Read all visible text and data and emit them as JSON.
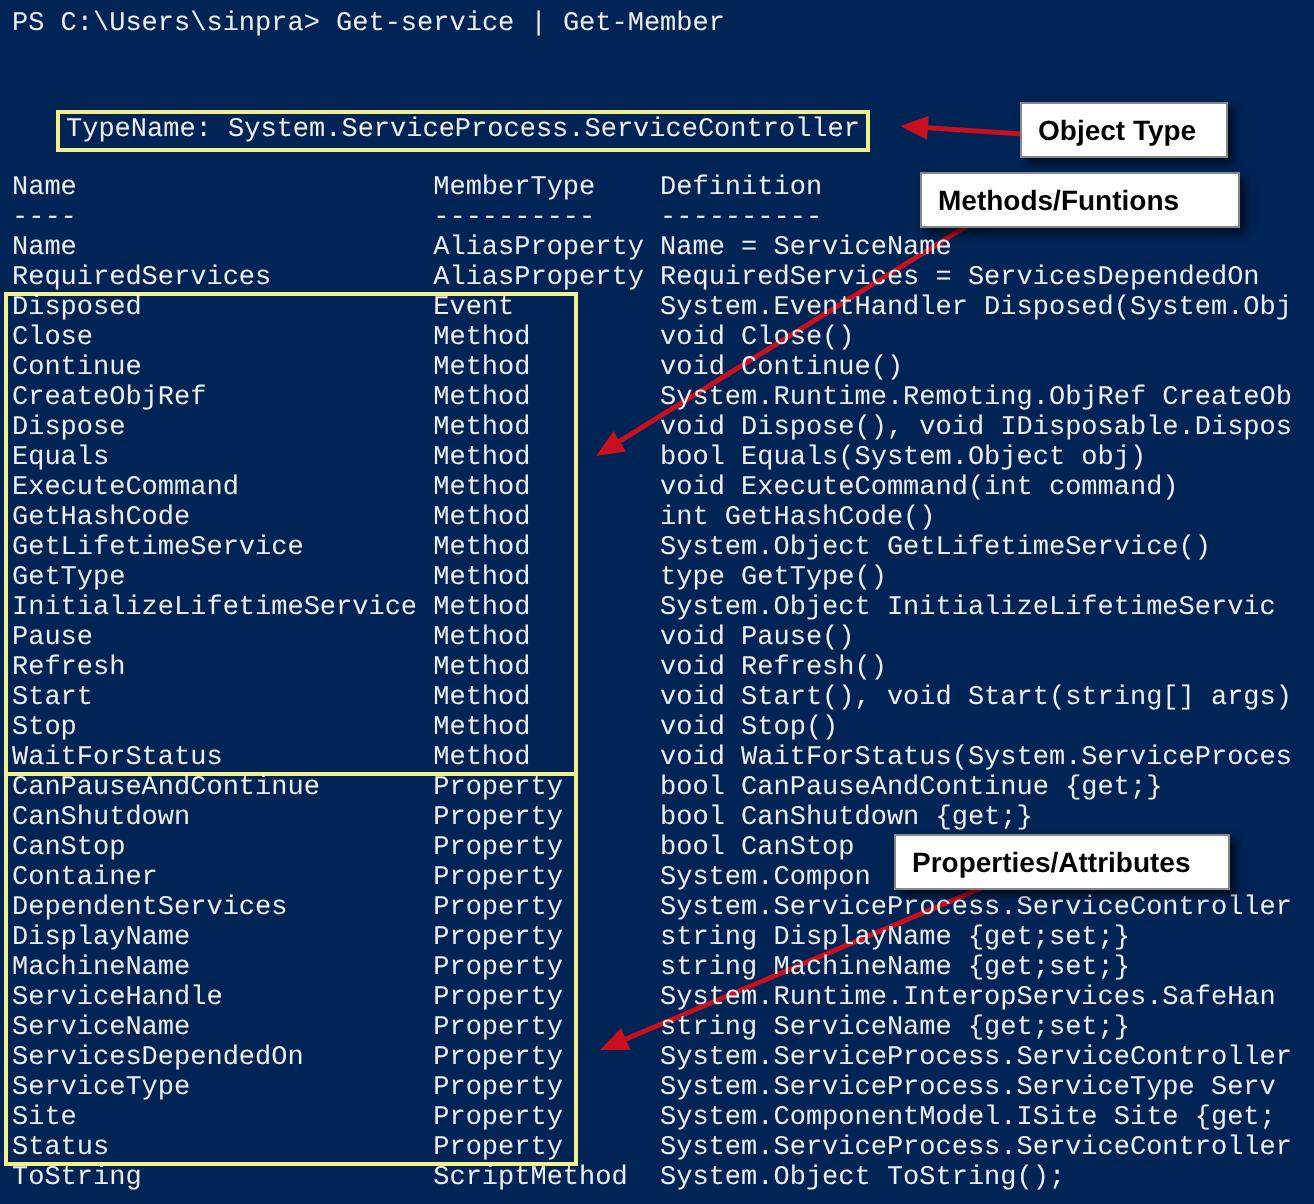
{
  "prompt": "PS C:\\Users\\sinpra> Get-service | Get-Member",
  "type_name": "TypeName: System.ServiceProcess.ServiceController",
  "columns": [
    {
      "header": "Name",
      "rule": "----"
    },
    {
      "header": "MemberType",
      "rule": "----------"
    },
    {
      "header": "Definition",
      "rule": "----------"
    }
  ],
  "groups": [
    {
      "kind": "plain",
      "rows": [
        {
          "name": "Name",
          "member_type": "AliasProperty",
          "definition": "Name = ServiceName"
        },
        {
          "name": "RequiredServices",
          "member_type": "AliasProperty",
          "definition": "RequiredServices = ServicesDependedOn"
        }
      ]
    },
    {
      "kind": "boxed",
      "rows": [
        {
          "name": "Disposed",
          "member_type": "Event",
          "definition": "System.EventHandler Disposed(System.Obj"
        },
        {
          "name": "Close",
          "member_type": "Method",
          "definition": "void Close()"
        },
        {
          "name": "Continue",
          "member_type": "Method",
          "definition": "void Continue()"
        },
        {
          "name": "CreateObjRef",
          "member_type": "Method",
          "definition": "System.Runtime.Remoting.ObjRef CreateOb"
        },
        {
          "name": "Dispose",
          "member_type": "Method",
          "definition": "void Dispose(), void IDisposable.Dispos"
        },
        {
          "name": "Equals",
          "member_type": "Method",
          "definition": "bool Equals(System.Object obj)"
        },
        {
          "name": "ExecuteCommand",
          "member_type": "Method",
          "definition": "void ExecuteCommand(int command)"
        },
        {
          "name": "GetHashCode",
          "member_type": "Method",
          "definition": "int GetHashCode()"
        },
        {
          "name": "GetLifetimeService",
          "member_type": "Method",
          "definition": "System.Object GetLifetimeService()"
        },
        {
          "name": "GetType",
          "member_type": "Method",
          "definition": "type GetType()"
        },
        {
          "name": "InitializeLifetimeService",
          "member_type": "Method",
          "definition": "System.Object InitializeLifetimeServic"
        },
        {
          "name": "Pause",
          "member_type": "Method",
          "definition": "void Pause()"
        },
        {
          "name": "Refresh",
          "member_type": "Method",
          "definition": "void Refresh()"
        },
        {
          "name": "Start",
          "member_type": "Method",
          "definition": "void Start(), void Start(string[] args)"
        },
        {
          "name": "Stop",
          "member_type": "Method",
          "definition": "void Stop()"
        },
        {
          "name": "WaitForStatus",
          "member_type": "Method",
          "definition": "void WaitForStatus(System.ServiceProces"
        }
      ]
    },
    {
      "kind": "boxed",
      "rows": [
        {
          "name": "CanPauseAndContinue",
          "member_type": "Property",
          "definition": "bool CanPauseAndContinue {get;}"
        },
        {
          "name": "CanShutdown",
          "member_type": "Property",
          "definition": "bool CanShutdown {get;}"
        },
        {
          "name": "CanStop",
          "member_type": "Property",
          "definition": "bool CanStop"
        },
        {
          "name": "Container",
          "member_type": "Property",
          "definition": "System.Compon"
        },
        {
          "name": "DependentServices",
          "member_type": "Property",
          "definition": "System.ServiceProcess.ServiceController"
        },
        {
          "name": "DisplayName",
          "member_type": "Property",
          "definition": "string DisplayName {get;set;}"
        },
        {
          "name": "MachineName",
          "member_type": "Property",
          "definition": "string MachineName {get;set;}"
        },
        {
          "name": "ServiceHandle",
          "member_type": "Property",
          "definition": "System.Runtime.InteropServices.SafeHan"
        },
        {
          "name": "ServiceName",
          "member_type": "Property",
          "definition": "string ServiceName {get;set;}"
        },
        {
          "name": "ServicesDependedOn",
          "member_type": "Property",
          "definition": "System.ServiceProcess.ServiceController"
        },
        {
          "name": "ServiceType",
          "member_type": "Property",
          "definition": "System.ServiceProcess.ServiceType Serv"
        },
        {
          "name": "Site",
          "member_type": "Property",
          "definition": "System.ComponentModel.ISite Site {get;"
        },
        {
          "name": "Status",
          "member_type": "Property",
          "definition": "System.ServiceProcess.ServiceController"
        }
      ]
    },
    {
      "kind": "plain",
      "rows": [
        {
          "name": "ToString",
          "member_type": "ScriptMethod",
          "definition": "System.Object ToString();"
        }
      ]
    }
  ],
  "annotations": [
    {
      "label": "Object Type"
    },
    {
      "label": "Methods/Funtions"
    },
    {
      "label": "Properties/Attributes"
    }
  ]
}
